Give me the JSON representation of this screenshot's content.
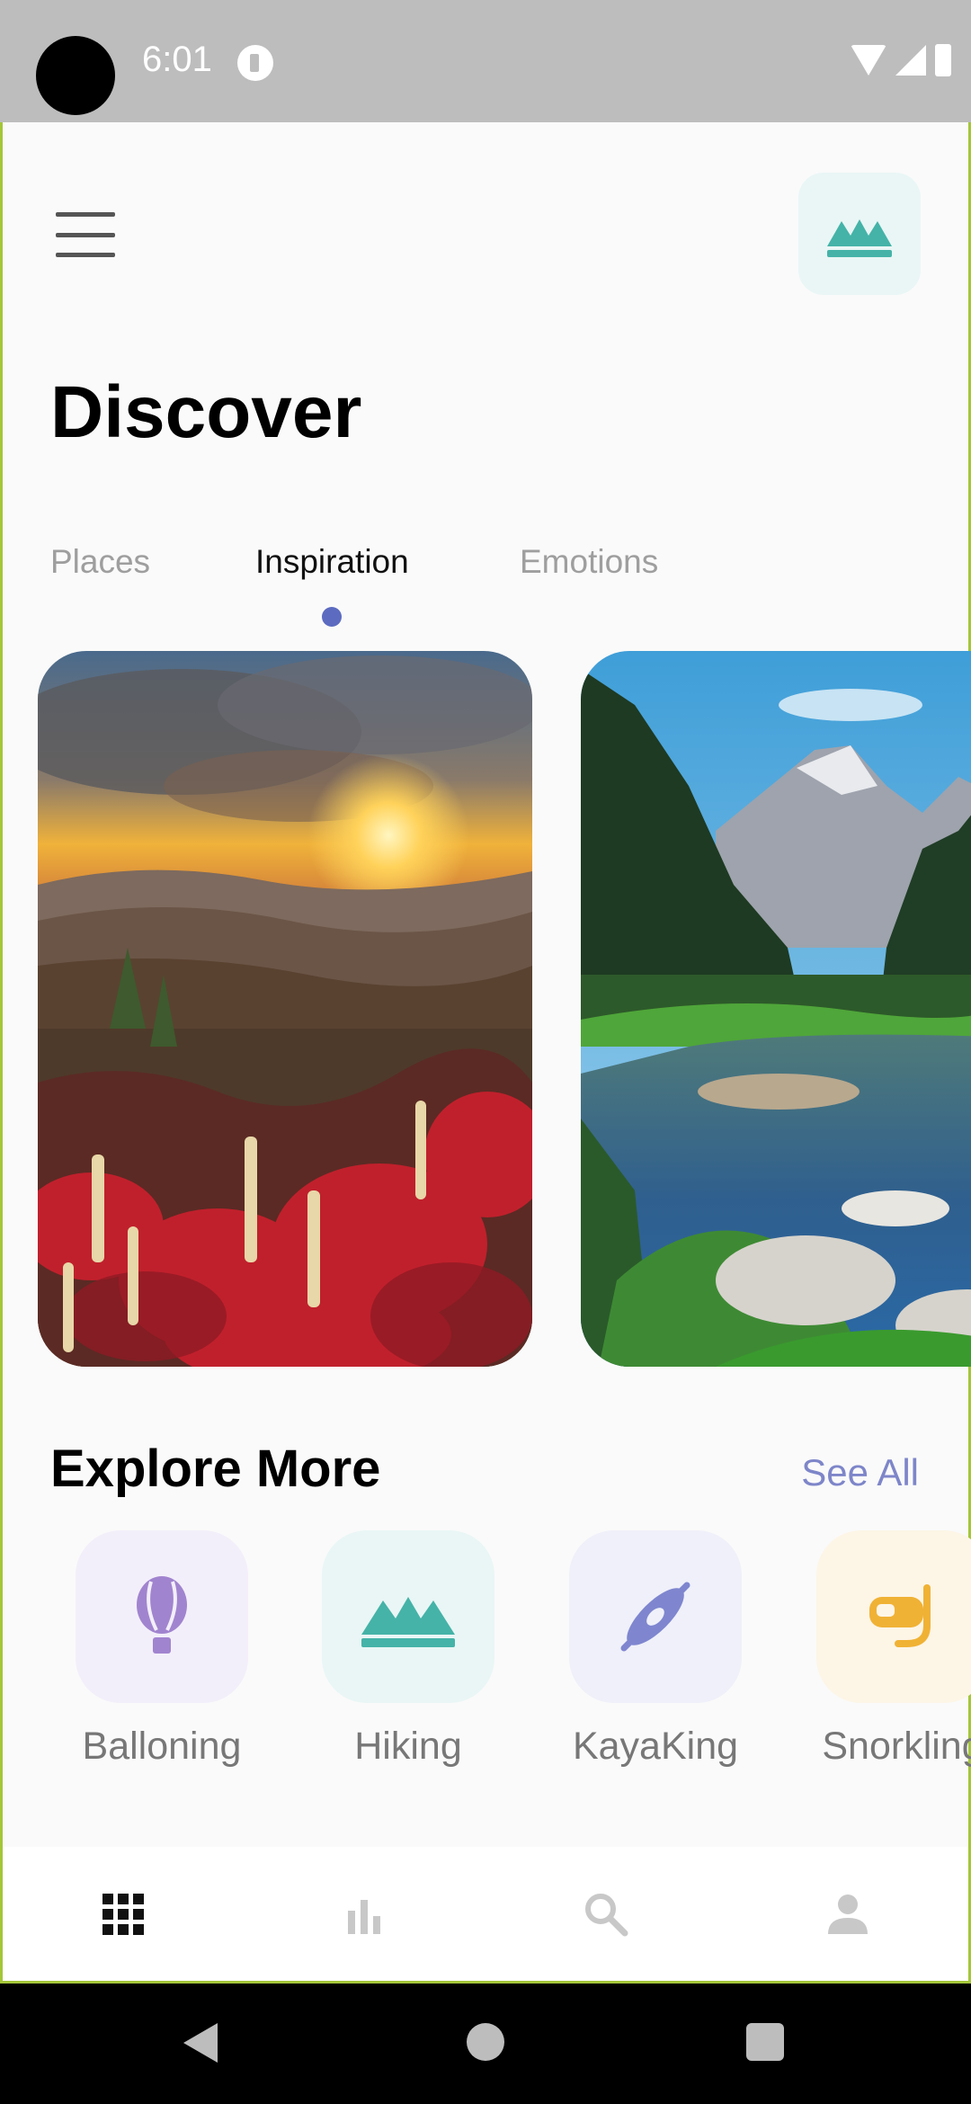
{
  "status_bar": {
    "time": "6:01"
  },
  "header": {
    "menu_icon": "hamburger-menu-icon",
    "profile_icon": "mountain-icon"
  },
  "page": {
    "title": "Discover"
  },
  "tabs": [
    {
      "label": "Places",
      "active": false
    },
    {
      "label": "Inspiration",
      "active": true
    },
    {
      "label": "Emotions",
      "active": false
    }
  ],
  "cards": [
    {
      "scene": "sunset-wildflower-meadow"
    },
    {
      "scene": "mountain-river-forest"
    }
  ],
  "explore": {
    "title": "Explore More",
    "see_all": "See All",
    "items": [
      {
        "label": "Balloning",
        "icon": "hot-air-balloon-icon",
        "tile_color": "#f3effa",
        "icon_color": "#a184cf"
      },
      {
        "label": "Hiking",
        "icon": "mountain-icon",
        "tile_color": "#e9f6f5",
        "icon_color": "#45b3a8"
      },
      {
        "label": "KayaKing",
        "icon": "kayak-icon",
        "tile_color": "#eff0f9",
        "icon_color": "#7f86cf"
      },
      {
        "label": "Snorkling",
        "icon": "snorkel-mask-icon",
        "tile_color": "#fdf5e6",
        "icon_color": "#f0b235"
      }
    ]
  },
  "bottom_nav": [
    {
      "icon": "grid-icon",
      "active": true
    },
    {
      "icon": "bar-chart-icon",
      "active": false
    },
    {
      "icon": "search-icon",
      "active": false
    },
    {
      "icon": "person-icon",
      "active": false
    }
  ],
  "colors": {
    "accent": "#5c6bc0",
    "see_all": "#7e86c9",
    "hiking_teal": "#45b3a8"
  }
}
